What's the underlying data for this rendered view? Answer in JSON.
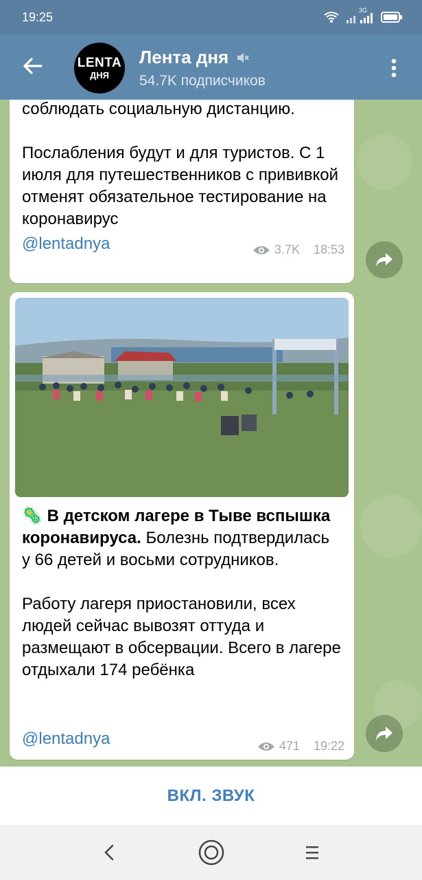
{
  "status": {
    "time": "19:25",
    "network_label": "3G"
  },
  "header": {
    "title": "Лента дня",
    "subtitle": "54.7K подписчиков",
    "avatar_line1": "LENTA",
    "avatar_line2": "ДНЯ"
  },
  "messages": [
    {
      "text": "соблюдать социальную дистанцию.\n\nПослабления будут и для туристов. С 1 июля для путешественников с прививкой отменят обязательное тестирование на коронавирус",
      "link": "@lentadnya",
      "views": "3.7K",
      "time": "18:53"
    },
    {
      "emoji": "🦠",
      "bold_text": "В детском лагере в Тыве вспышка коронавируса.",
      "text": " Болезнь подтвердилась у 66 детей и восьми сотрудников.\n\nРаботу лагеря приостановили, всех людей сейчас вывозят оттуда  и размещают в обсервации. Всего в лагере отдыхали 174 ребёнка",
      "link": "@lentadnya",
      "views": "471",
      "time": "19:22"
    }
  ],
  "footer": {
    "sound_button": "ВКЛ. ЗВУК"
  },
  "colors": {
    "header_bg": "#5f88ad",
    "link": "#3a7fb8",
    "accent": "#3d7fbf"
  }
}
